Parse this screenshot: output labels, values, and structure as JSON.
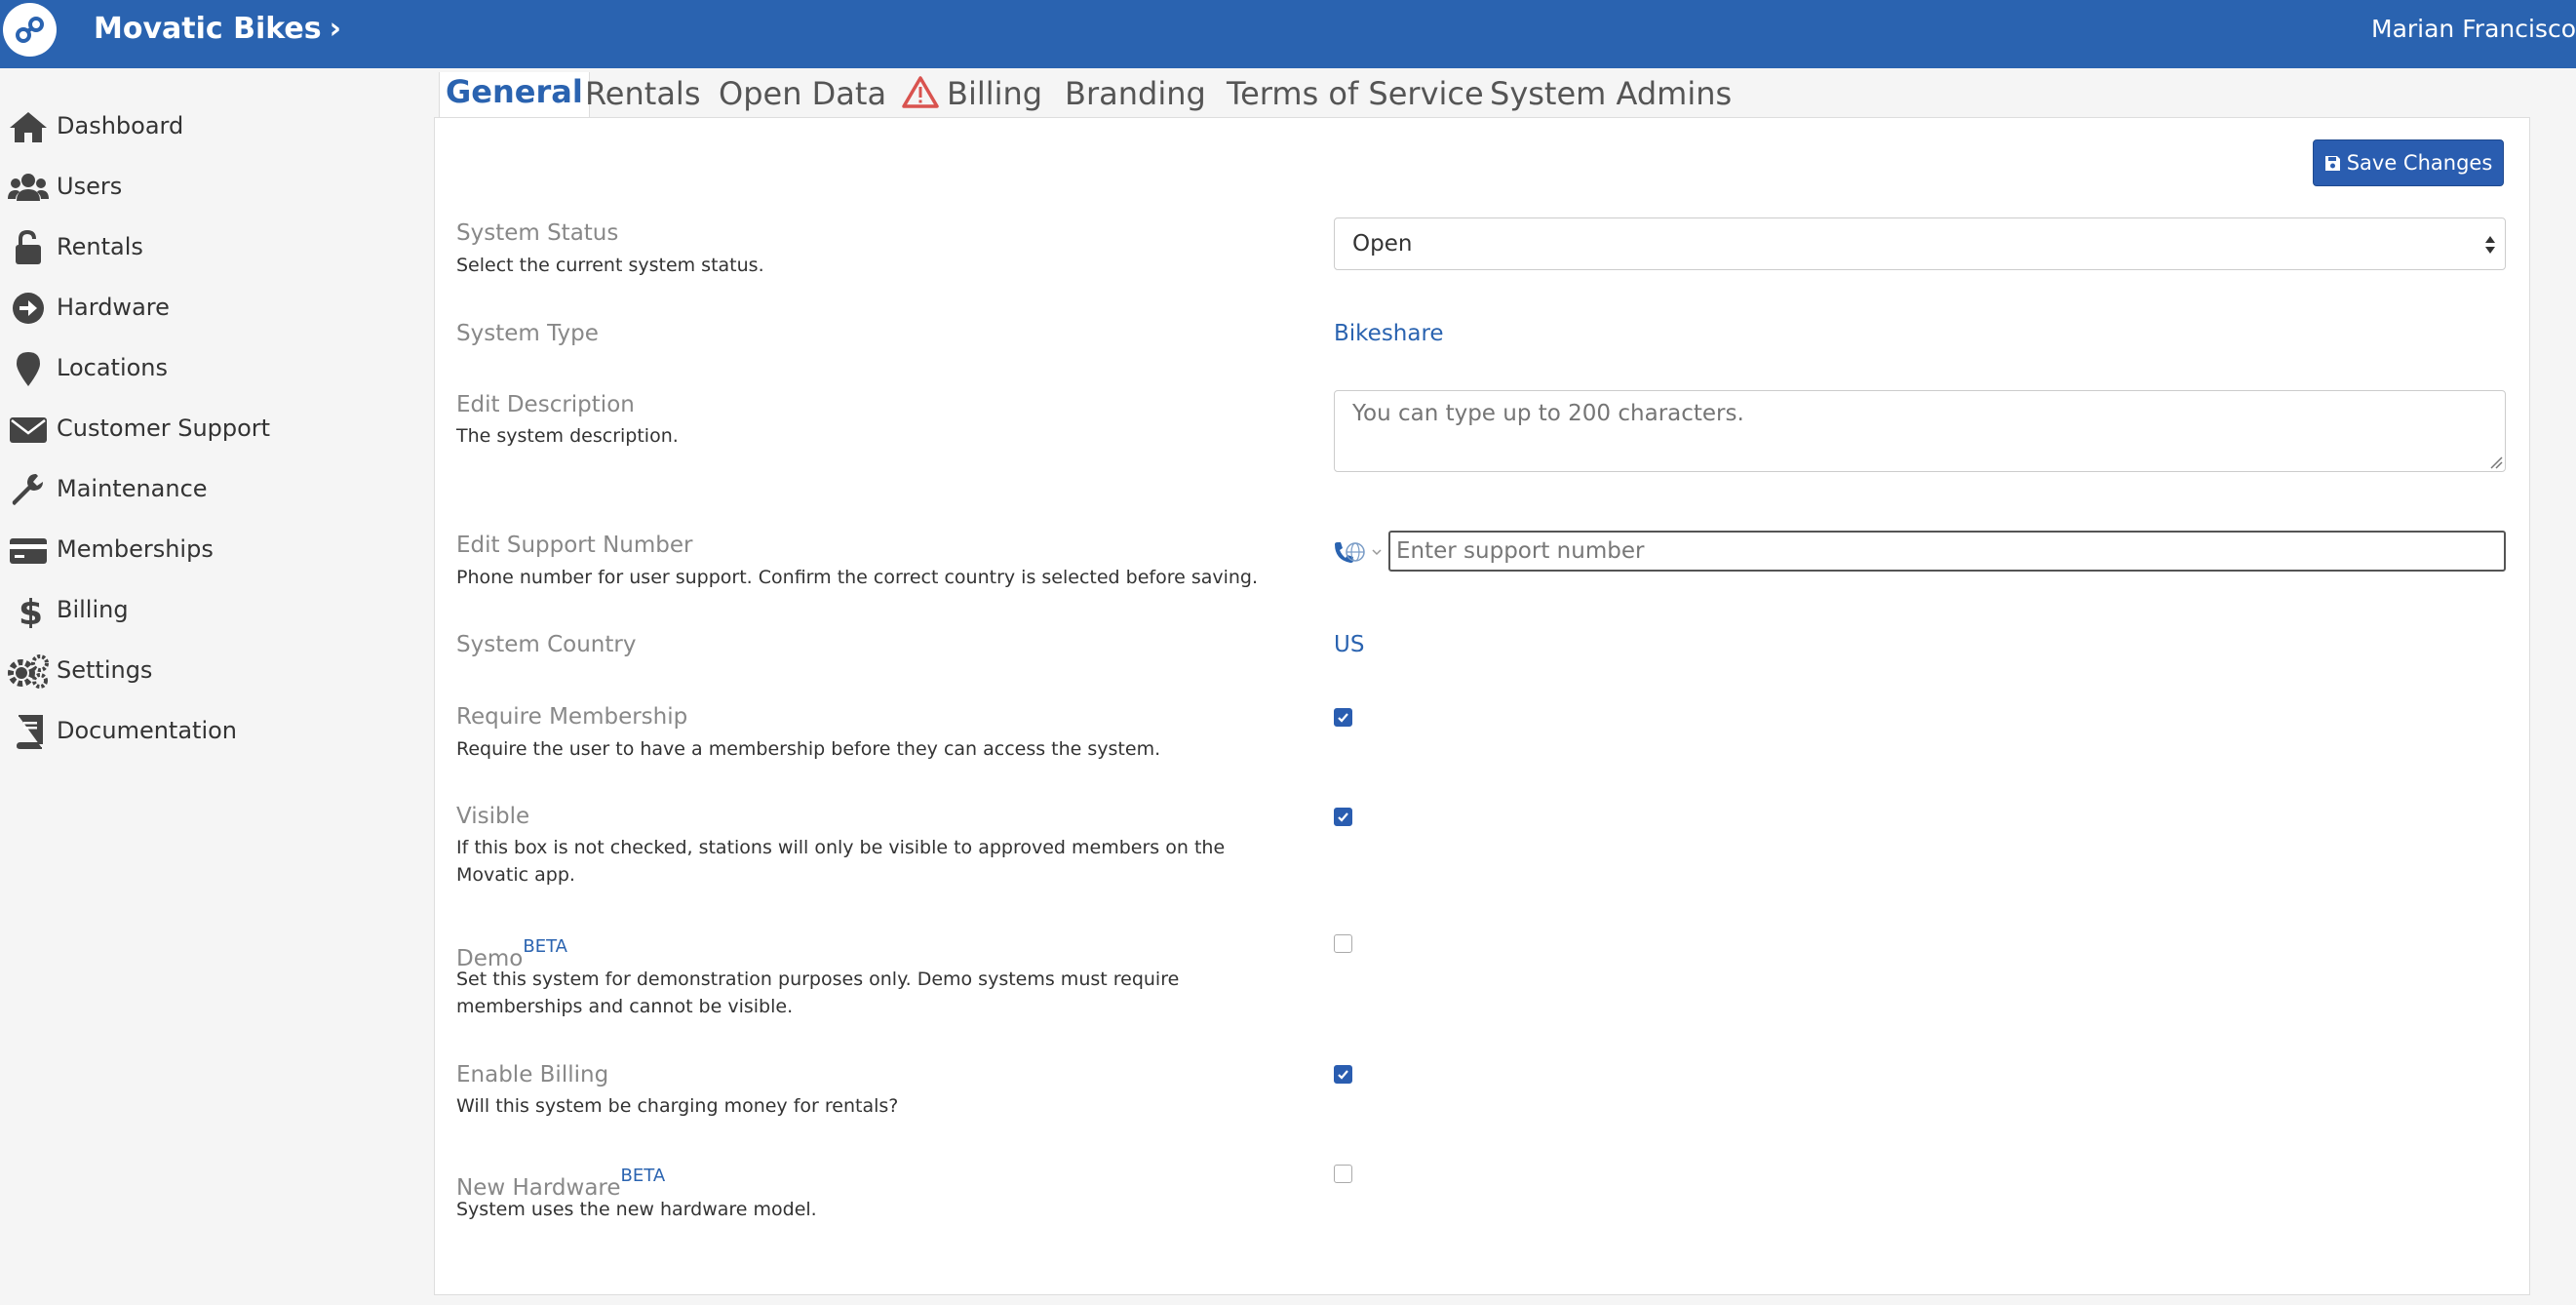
{
  "header": {
    "brand": "Movatic Bikes",
    "brand_chevron": "›",
    "user": "Marian Francisco",
    "logo_icon": "bike-chain-logo"
  },
  "sidebar": {
    "items": [
      {
        "label": "Dashboard",
        "icon": "home-icon"
      },
      {
        "label": "Users",
        "icon": "users-icon"
      },
      {
        "label": "Rentals",
        "icon": "unlock-icon"
      },
      {
        "label": "Hardware",
        "icon": "arrow-circle-icon"
      },
      {
        "label": "Locations",
        "icon": "map-pin-icon"
      },
      {
        "label": "Customer Support",
        "icon": "envelope-icon"
      },
      {
        "label": "Maintenance",
        "icon": "wrench-icon"
      },
      {
        "label": "Memberships",
        "icon": "credit-card-icon"
      },
      {
        "label": "Billing",
        "icon": "dollar-icon"
      },
      {
        "label": "Settings",
        "icon": "gears-icon"
      },
      {
        "label": "Documentation",
        "icon": "book-icon"
      }
    ]
  },
  "tabs": [
    {
      "label": "General",
      "active": true
    },
    {
      "label": "Rentals"
    },
    {
      "label": "Open Data"
    },
    {
      "label": "Billing",
      "warning": true
    },
    {
      "label": "Branding"
    },
    {
      "label": "Terms of Service"
    },
    {
      "label": "System Admins"
    }
  ],
  "form": {
    "save_label": "Save Changes",
    "system_status": {
      "label": "System Status",
      "help": "Select the current system status.",
      "value": "Open"
    },
    "system_type": {
      "label": "System Type",
      "value": "Bikeshare"
    },
    "description": {
      "label": "Edit Description",
      "help": "The system description.",
      "placeholder": "You can type up to 200 characters."
    },
    "support_number": {
      "label": "Edit Support Number",
      "help": "Phone number for user support. Confirm the correct country is selected before saving.",
      "placeholder": "Enter support number"
    },
    "system_country": {
      "label": "System Country",
      "value": "US"
    },
    "require_membership": {
      "label": "Require Membership",
      "help": "Require the user to have a membership before they can access the system.",
      "checked": true
    },
    "visible": {
      "label": "Visible",
      "help": "If this box is not checked, stations will only be visible to approved members on the Movatic app.",
      "checked": true
    },
    "demo": {
      "label": "Demo",
      "badge": "BETA",
      "help": "Set this system for demonstration purposes only. Demo systems must require memberships and cannot be visible.",
      "checked": false
    },
    "enable_billing": {
      "label": "Enable Billing",
      "help": "Will this system be charging money for rentals?",
      "checked": true
    },
    "new_hardware": {
      "label": "New Hardware",
      "badge": "BETA",
      "help": "System uses the new hardware model.",
      "checked": false
    }
  },
  "colors": {
    "brand_blue": "#2a63b0",
    "warning_red": "#d9534f"
  }
}
